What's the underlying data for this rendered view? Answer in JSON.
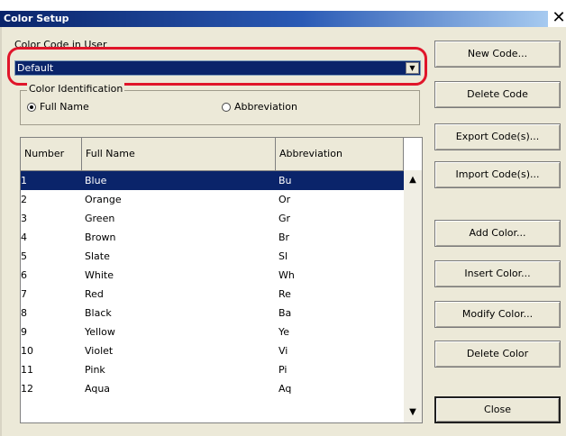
{
  "window": {
    "title": "Color Setup",
    "close_glyph": "✕"
  },
  "color_code": {
    "label": "Color Code in User",
    "selected": "Default",
    "dropdown_glyph": "▼"
  },
  "identification": {
    "label": "Color Identification",
    "options": [
      {
        "label": "Full Name",
        "selected": true
      },
      {
        "label": "Abbreviation",
        "selected": false
      }
    ]
  },
  "table": {
    "columns": [
      "Number",
      "Full Name",
      "Abbreviation"
    ],
    "rows": [
      {
        "number": "1",
        "name": "Blue",
        "abbr": "Bu",
        "selected": true
      },
      {
        "number": "2",
        "name": "Orange",
        "abbr": "Or"
      },
      {
        "number": "3",
        "name": "Green",
        "abbr": "Gr"
      },
      {
        "number": "4",
        "name": "Brown",
        "abbr": "Br"
      },
      {
        "number": "5",
        "name": "Slate",
        "abbr": "Sl"
      },
      {
        "number": "6",
        "name": "White",
        "abbr": "Wh"
      },
      {
        "number": "7",
        "name": "Red",
        "abbr": "Re"
      },
      {
        "number": "8",
        "name": "Black",
        "abbr": "Ba"
      },
      {
        "number": "9",
        "name": "Yellow",
        "abbr": "Ye"
      },
      {
        "number": "10",
        "name": "Violet",
        "abbr": "Vi"
      },
      {
        "number": "11",
        "name": "Pink",
        "abbr": "Pi"
      },
      {
        "number": "12",
        "name": "Aqua",
        "abbr": "Aq"
      }
    ],
    "scroll_up_glyph": "▲",
    "scroll_down_glyph": "▼"
  },
  "buttons": {
    "new_code": "New Code...",
    "delete_code": "Delete Code",
    "export_codes": "Export Code(s)...",
    "import_codes": "Import Code(s)...",
    "add_color": "Add Color...",
    "insert_color": "Insert Color...",
    "modify_color": "Modify Color...",
    "delete_color": "Delete Color",
    "close": "Close"
  },
  "colors": {
    "selection": "#0a246a",
    "highlight_annotation": "#e0152a",
    "dialog_background": "#ece9d8"
  }
}
